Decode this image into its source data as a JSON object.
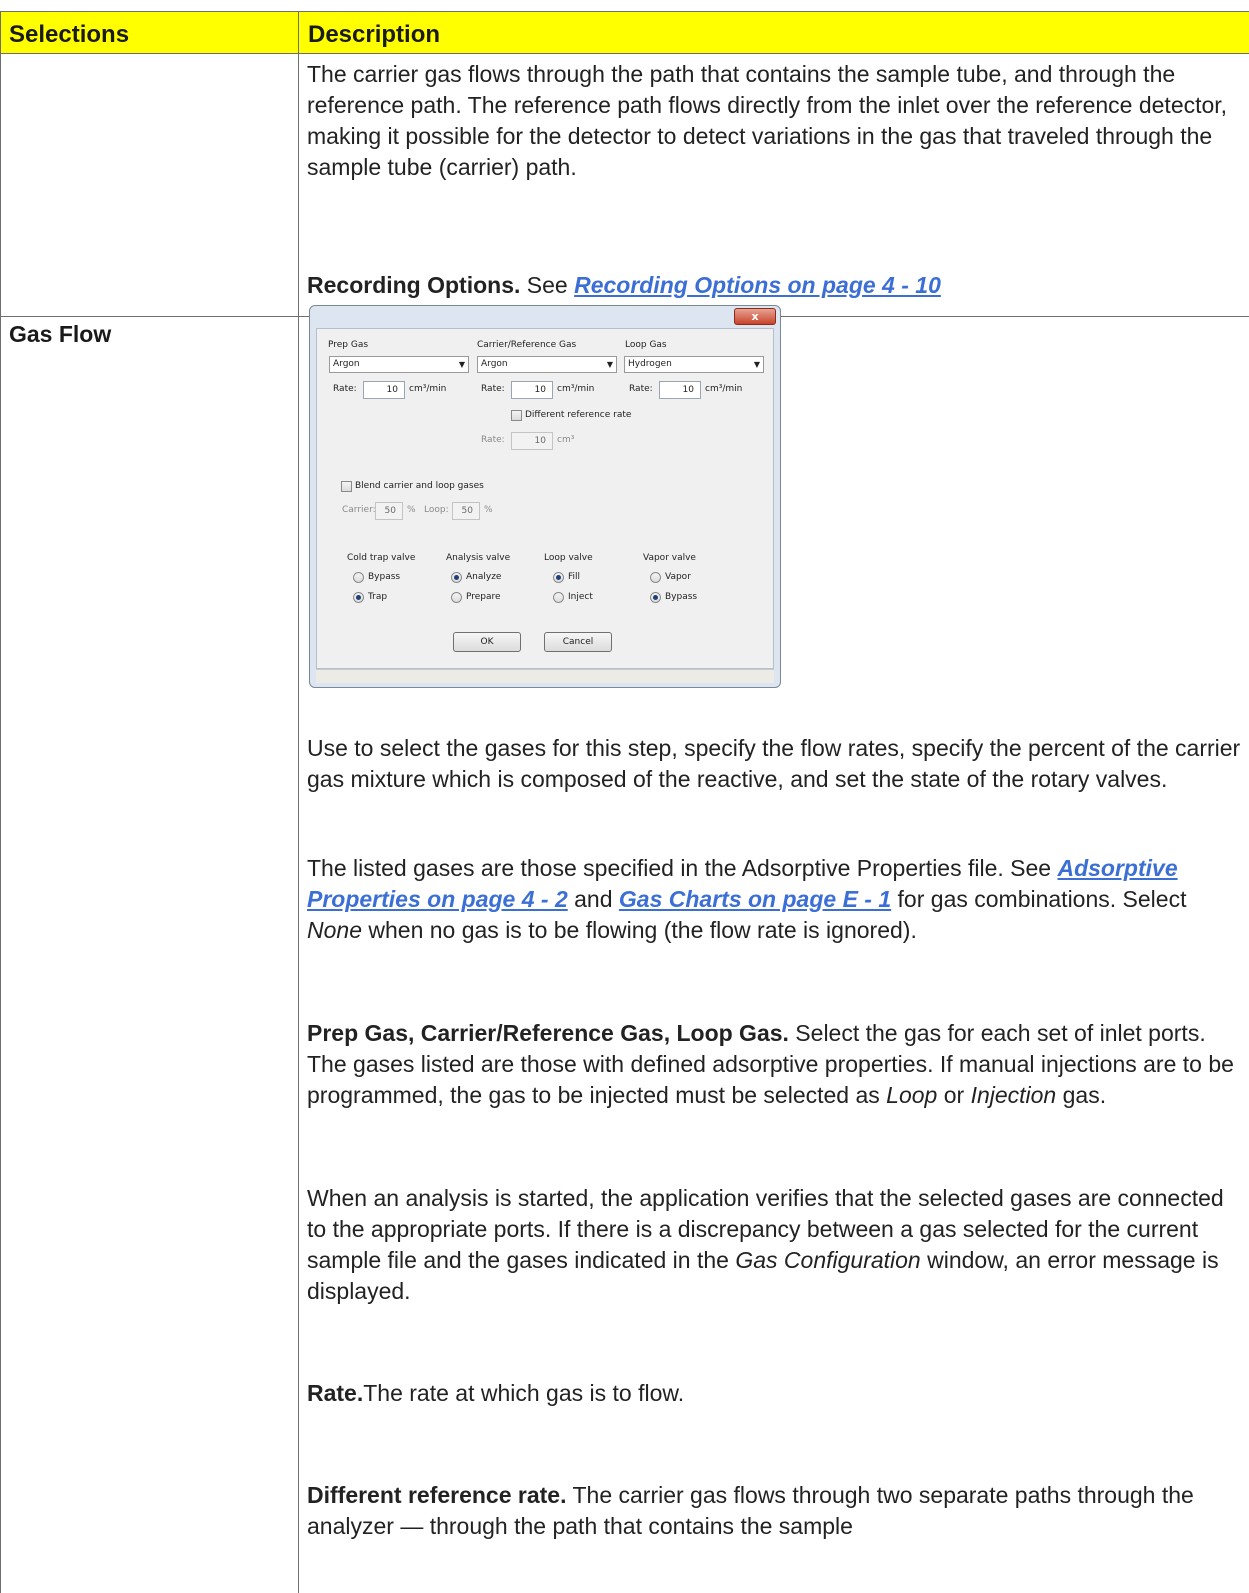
{
  "header": {
    "col1": "Selections",
    "col2": "Description",
    "bg_color": "#ffff00"
  },
  "row1": {
    "para1": "The carrier gas flows through the path that contains the sample tube, and through the reference path. The reference path flows directly from the inlet over the reference detector, making it possible for the detector to detect variations in the gas that traveled through the sample tube (carrier) path.",
    "rec_bold": "Recording Options.",
    "rec_see": " See ",
    "rec_link": "Recording Options on page 4 - 10"
  },
  "row2": {
    "label": "Gas Flow",
    "dialog": {
      "close": "x",
      "prep_gas_label": "Prep Gas",
      "carrier_gas_label": "Carrier/Reference Gas",
      "loop_gas_label": "Loop Gas",
      "prep_gas_value": "Argon",
      "carrier_gas_value": "Argon",
      "loop_gas_value": "Hydrogen",
      "rate_label": "Rate:",
      "prep_rate": "10",
      "carrier_rate": "10",
      "loop_rate": "10",
      "rate_unit": "cm³/min",
      "diff_ref_label": "Different reference rate",
      "ref_rate": "10",
      "ref_unit": "cm³",
      "blend_label": "Blend carrier and loop gases",
      "carrier_label": "Carrier:",
      "carrier_pct": "50",
      "loop_label": "Loop:",
      "loop_pct": "50",
      "pct": "%",
      "cold_trap_label": "Cold trap valve",
      "cold_opt1": "Bypass",
      "cold_opt2": "Trap",
      "analysis_label": "Analysis valve",
      "analysis_opt1": "Analyze",
      "analysis_opt2": "Prepare",
      "loop_valve_label": "Loop valve",
      "loop_opt1": "Fill",
      "loop_opt2": "Inject",
      "vapor_label": "Vapor valve",
      "vapor_opt1": "Vapor",
      "vapor_opt2": "Bypass",
      "ok": "OK",
      "cancel": "Cancel"
    },
    "p1": "Use to select the gases for this step, specify the flow rates, specify the percent of the carrier gas mixture which is composed of the reactive, and set the state of the rotary valves.",
    "p2_a": "The listed gases are those specified in the Adsorptive Properties file. See ",
    "p2_link1": "Adsorptive Properties on page 4 - 2",
    "p2_and": " and ",
    "p2_link2": "Gas Charts on page E - 1",
    "p2_b": " for gas combinations. Select ",
    "p2_none": "None",
    "p2_c": " when no gas is to be flowing (the flow rate is ignored).",
    "p3_bold": "Prep Gas, Carrier/Reference Gas, Loop Gas.",
    "p3_a": "  Select the gas for each set of inlet ports. The gases listed are those with defined adsorptive properties. If manual injections are to be programmed, the gas to be injected must be selected as ",
    "p3_loop": "Loop",
    "p3_or": " or ",
    "p3_inj": "Injection",
    "p3_b": " gas.",
    "p4_a": "When an analysis is started, the application verifies that the selected gases are connected to the appropriate ports. If there is a discrepancy between a gas selected for the current sample file and the gases indicated in the ",
    "p4_gc": "Gas Configuration",
    "p4_b": " window, an error message is displayed.",
    "p5_bold": "Rate.",
    "p5": "The rate at which gas is to flow.",
    "p6_bold": "Different reference rate.",
    "p6": " The carrier gas flows through two separate paths through the analyzer — through the path that contains the sample"
  }
}
